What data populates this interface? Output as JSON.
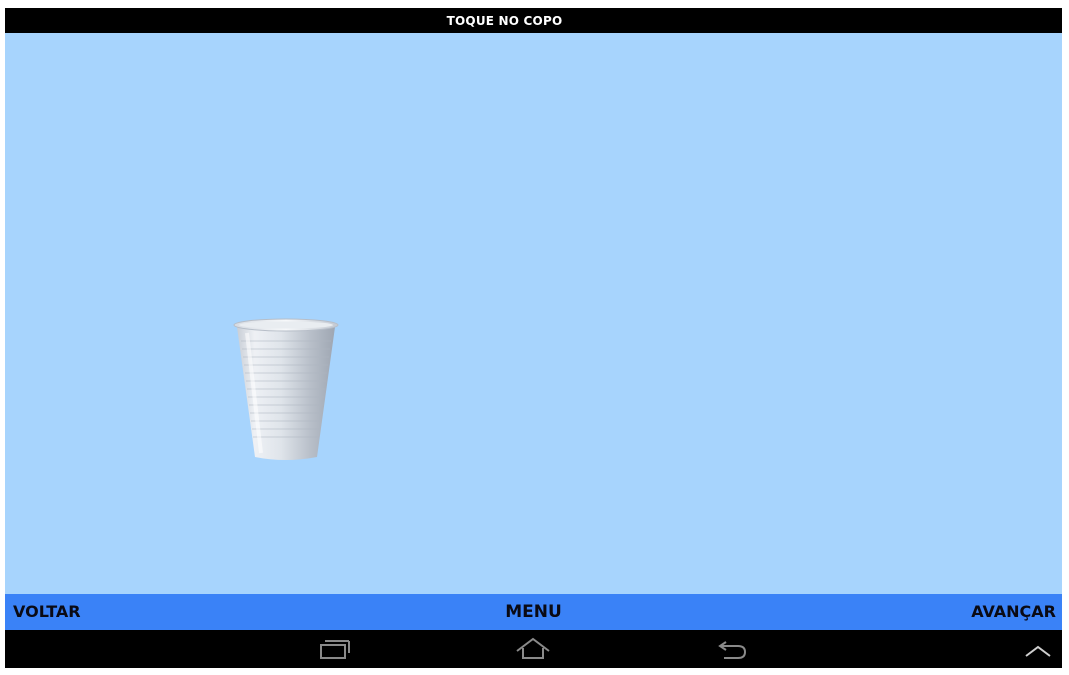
{
  "header": {
    "title": "TOQUE NO COPO"
  },
  "main": {
    "object_icon": "plastic-cup"
  },
  "bottom_nav": {
    "back_label": "VOLTAR",
    "menu_label": "MENU",
    "next_label": "AVANÇAR"
  },
  "system_nav": {
    "icons": [
      "recent-apps-icon",
      "home-icon",
      "back-icon",
      "chevron-up-icon"
    ]
  },
  "colors": {
    "background": "#a7d4fd",
    "nav_bar": "#3a82f7",
    "title_bar": "#000000"
  }
}
